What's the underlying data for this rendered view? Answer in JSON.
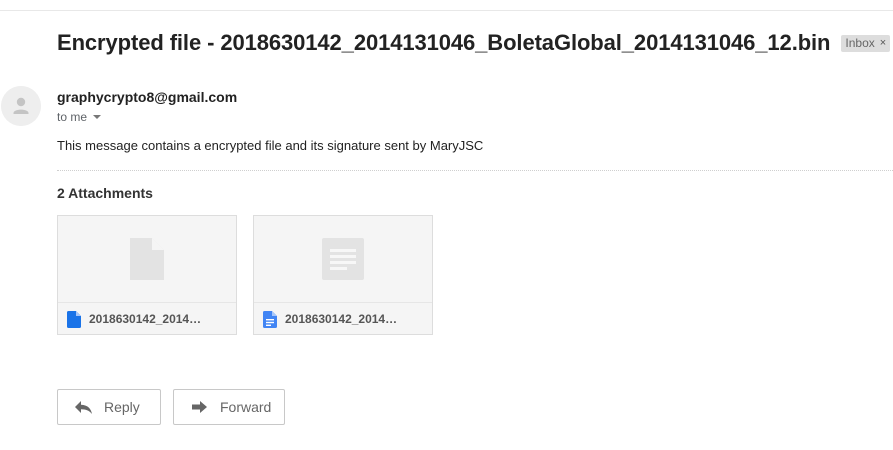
{
  "email": {
    "subject": "Encrypted file - 2018630142_2014131046_BoletaGlobal_2014131046_12.bin",
    "label": {
      "name": "Inbox",
      "close_glyph": "×"
    },
    "sender": "graphycrypto8@gmail.com",
    "recipient_label": "to me",
    "body": "This message contains a encrypted file and its signature sent by MaryJSC"
  },
  "attachments": {
    "title": "2 Attachments",
    "items": [
      {
        "name": "2018630142_2014…",
        "icon": "generic-file-icon",
        "type_color": "#1a73e8"
      },
      {
        "name": "2018630142_2014…",
        "icon": "document-icon",
        "type_color": "#4285f4"
      }
    ]
  },
  "actions": {
    "reply_label": "Reply",
    "forward_label": "Forward"
  },
  "colors": {
    "file_icon_blue": "#1a73e8",
    "fold_dark": "#555555",
    "fold_blue": "#4285f4",
    "label_chip_bg": "#dddddd"
  }
}
